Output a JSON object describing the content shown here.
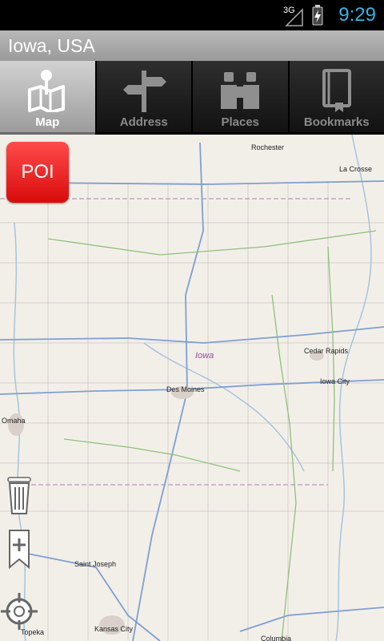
{
  "status_bar": {
    "network": "3G",
    "time": "9:29",
    "accent_color": "#33b5e5"
  },
  "title": "Iowa, USA",
  "tabs": [
    {
      "label": "Map",
      "icon": "map-pin-icon",
      "active": true
    },
    {
      "label": "Address",
      "icon": "signpost-icon",
      "active": false
    },
    {
      "label": "Places",
      "icon": "binoculars-icon",
      "active": false
    },
    {
      "label": "Bookmarks",
      "icon": "bookmark-book-icon",
      "active": false
    }
  ],
  "map": {
    "state_label": "Iowa",
    "cities": {
      "rochester": "Rochester",
      "la_crosse": "La Crosse",
      "cedar_rapids": "Cedar Rapids",
      "iowa_city": "Iowa City",
      "des_moines": "Des Moines",
      "omaha": "Omaha",
      "saint_joseph": "Saint Joseph",
      "kansas_city": "Kansas City",
      "topeka": "Topeka",
      "columbia": "Columbia"
    }
  },
  "buttons": {
    "poi": "POI",
    "poi_color": "#e81818",
    "trash_icon": "trash-icon",
    "add_bookmark_icon": "add-bookmark-icon",
    "locate_icon": "crosshair-locate-icon"
  }
}
